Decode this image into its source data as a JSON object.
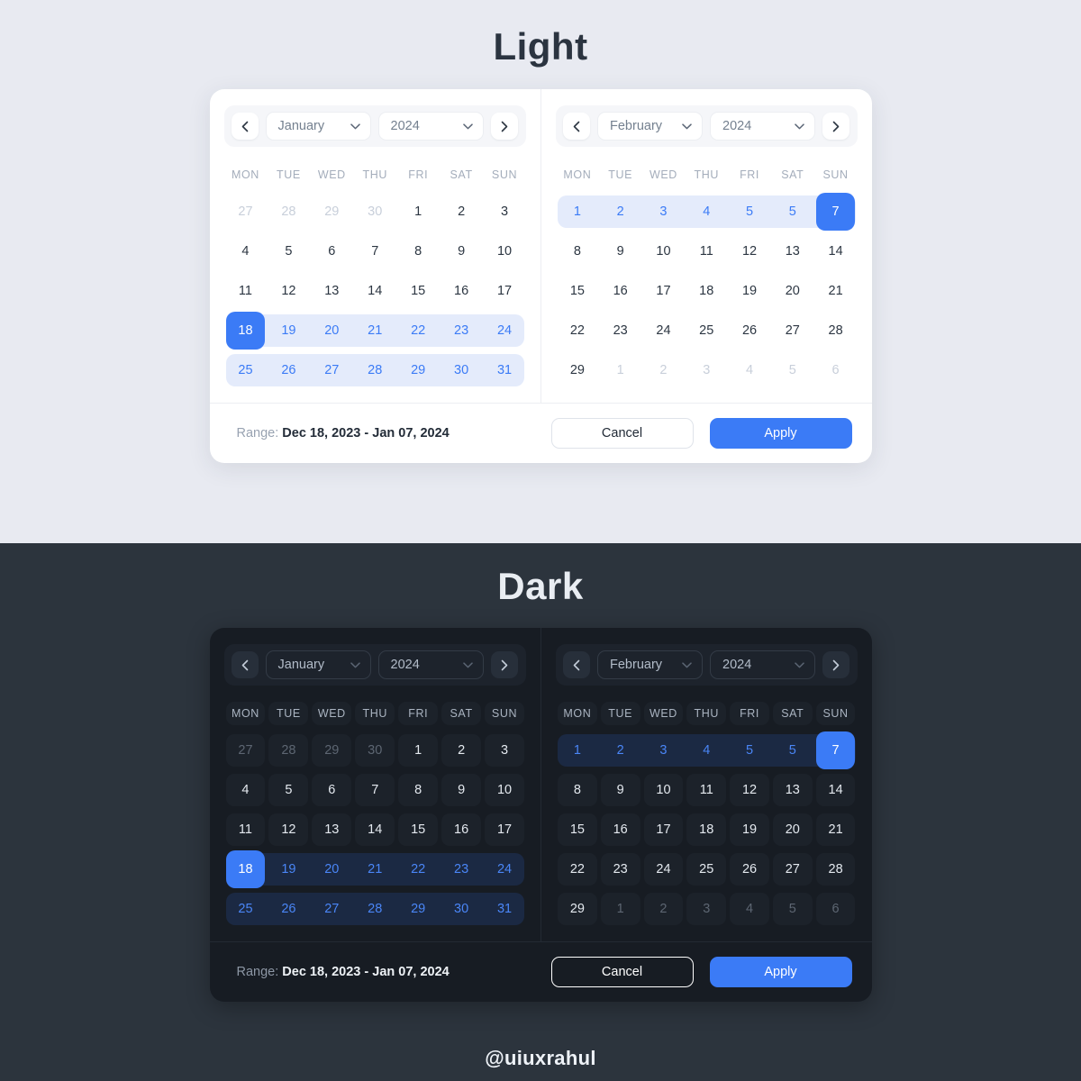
{
  "sections": {
    "light": {
      "title": "Light"
    },
    "dark": {
      "title": "Dark"
    }
  },
  "watermark": "@uiuxrahul",
  "colors": {
    "accent": "#3b7bf6",
    "range_band_light": "#e4ebfb",
    "range_band_dark": "#1b2943",
    "page_bg_light": "#e8eaf1",
    "page_bg_dark": "#2c343d",
    "card_bg_light": "#ffffff",
    "card_bg_dark": "#171c23"
  },
  "weekdays": [
    "MON",
    "TUE",
    "WED",
    "THU",
    "FRI",
    "SAT",
    "SUN"
  ],
  "panels": {
    "left": {
      "month": "January",
      "year": "2024",
      "prev_icon": "chevron-left-icon",
      "next_icon": "chevron-right-icon",
      "weeks": [
        [
          {
            "d": "27",
            "s": "muted"
          },
          {
            "d": "28",
            "s": "muted"
          },
          {
            "d": "29",
            "s": "muted"
          },
          {
            "d": "30",
            "s": "muted"
          },
          {
            "d": "1",
            "s": ""
          },
          {
            "d": "2",
            "s": ""
          },
          {
            "d": "3",
            "s": ""
          }
        ],
        [
          {
            "d": "4",
            "s": ""
          },
          {
            "d": "5",
            "s": ""
          },
          {
            "d": "6",
            "s": ""
          },
          {
            "d": "7",
            "s": ""
          },
          {
            "d": "8",
            "s": ""
          },
          {
            "d": "9",
            "s": ""
          },
          {
            "d": "10",
            "s": ""
          }
        ],
        [
          {
            "d": "11",
            "s": ""
          },
          {
            "d": "12",
            "s": ""
          },
          {
            "d": "13",
            "s": ""
          },
          {
            "d": "14",
            "s": ""
          },
          {
            "d": "15",
            "s": ""
          },
          {
            "d": "16",
            "s": ""
          },
          {
            "d": "17",
            "s": ""
          }
        ],
        [
          {
            "d": "18",
            "s": "selected"
          },
          {
            "d": "19",
            "s": "in-range"
          },
          {
            "d": "20",
            "s": "in-range"
          },
          {
            "d": "21",
            "s": "in-range"
          },
          {
            "d": "22",
            "s": "in-range"
          },
          {
            "d": "23",
            "s": "in-range"
          },
          {
            "d": "24",
            "s": "in-range"
          }
        ],
        [
          {
            "d": "25",
            "s": "in-range"
          },
          {
            "d": "26",
            "s": "in-range"
          },
          {
            "d": "27",
            "s": "in-range"
          },
          {
            "d": "28",
            "s": "in-range"
          },
          {
            "d": "29",
            "s": "in-range"
          },
          {
            "d": "30",
            "s": "in-range"
          },
          {
            "d": "31",
            "s": "in-range"
          }
        ]
      ],
      "range_weeks": [
        false,
        false,
        false,
        true,
        true
      ]
    },
    "right": {
      "month": "February",
      "year": "2024",
      "prev_icon": "chevron-left-icon",
      "next_icon": "chevron-right-icon",
      "weeks": [
        [
          {
            "d": "1",
            "s": "in-range"
          },
          {
            "d": "2",
            "s": "in-range"
          },
          {
            "d": "3",
            "s": "in-range"
          },
          {
            "d": "4",
            "s": "in-range"
          },
          {
            "d": "5",
            "s": "in-range"
          },
          {
            "d": "5",
            "s": "in-range"
          },
          {
            "d": "7",
            "s": "selected"
          }
        ],
        [
          {
            "d": "8",
            "s": ""
          },
          {
            "d": "9",
            "s": ""
          },
          {
            "d": "10",
            "s": ""
          },
          {
            "d": "11",
            "s": ""
          },
          {
            "d": "12",
            "s": ""
          },
          {
            "d": "13",
            "s": ""
          },
          {
            "d": "14",
            "s": ""
          }
        ],
        [
          {
            "d": "15",
            "s": ""
          },
          {
            "d": "16",
            "s": ""
          },
          {
            "d": "17",
            "s": ""
          },
          {
            "d": "18",
            "s": ""
          },
          {
            "d": "19",
            "s": ""
          },
          {
            "d": "20",
            "s": ""
          },
          {
            "d": "21",
            "s": ""
          }
        ],
        [
          {
            "d": "22",
            "s": ""
          },
          {
            "d": "23",
            "s": ""
          },
          {
            "d": "24",
            "s": ""
          },
          {
            "d": "25",
            "s": ""
          },
          {
            "d": "26",
            "s": ""
          },
          {
            "d": "27",
            "s": ""
          },
          {
            "d": "28",
            "s": ""
          }
        ],
        [
          {
            "d": "29",
            "s": ""
          },
          {
            "d": "1",
            "s": "muted"
          },
          {
            "d": "2",
            "s": "muted"
          },
          {
            "d": "3",
            "s": "muted"
          },
          {
            "d": "4",
            "s": "muted"
          },
          {
            "d": "5",
            "s": "muted"
          },
          {
            "d": "6",
            "s": "muted"
          }
        ]
      ],
      "range_weeks": [
        true,
        false,
        false,
        false,
        false
      ]
    }
  },
  "footer": {
    "range_label": "Range:",
    "range_value": "Dec 18, 2023 - Jan 07, 2024",
    "cancel_label": "Cancel",
    "apply_label": "Apply"
  }
}
